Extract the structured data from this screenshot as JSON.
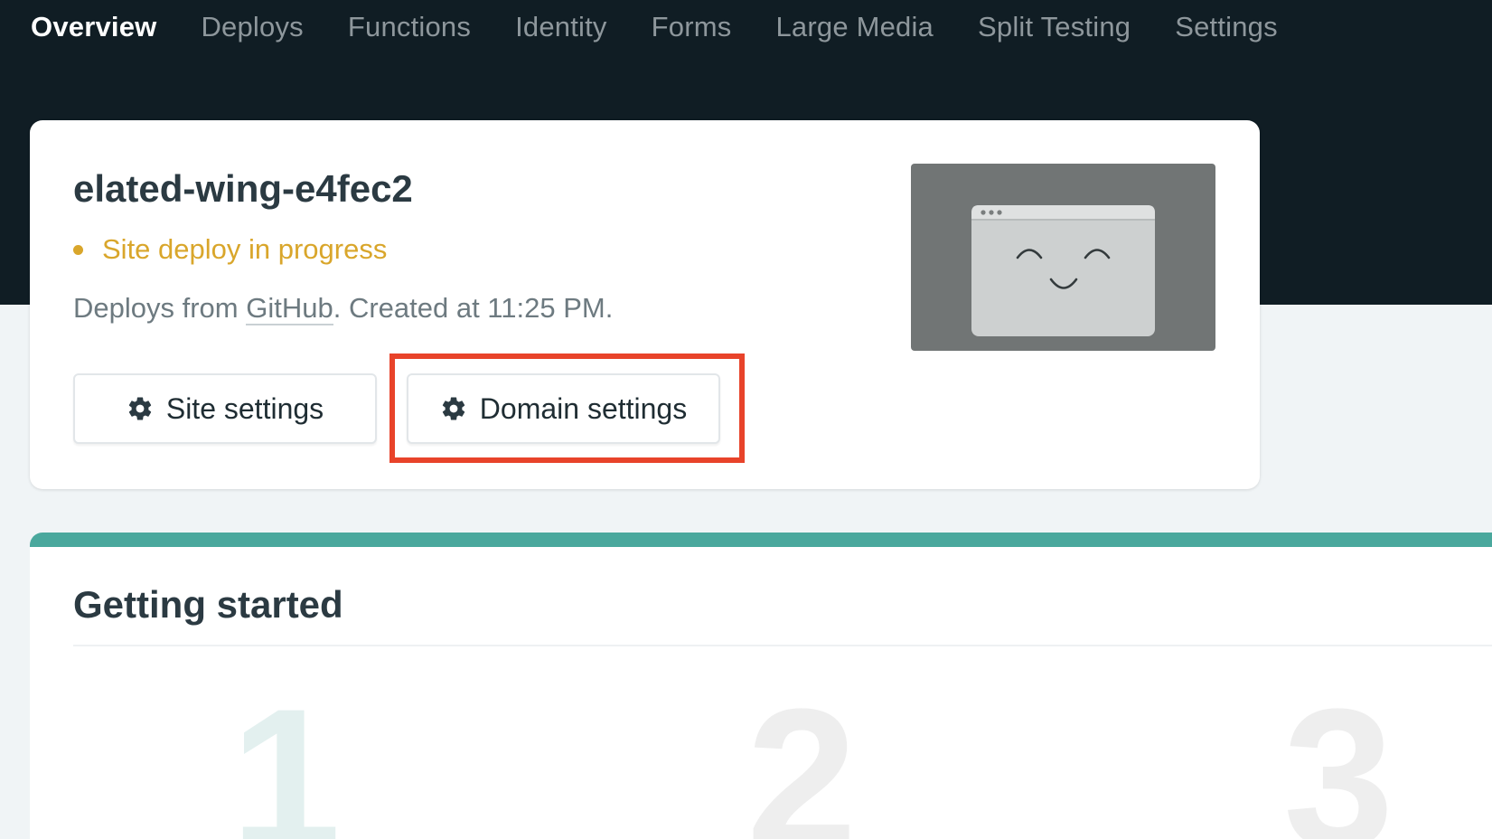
{
  "nav": {
    "tabs": [
      {
        "label": "Overview",
        "active": true
      },
      {
        "label": "Deploys"
      },
      {
        "label": "Functions"
      },
      {
        "label": "Identity"
      },
      {
        "label": "Forms"
      },
      {
        "label": "Large Media"
      },
      {
        "label": "Split Testing"
      },
      {
        "label": "Settings"
      }
    ]
  },
  "site": {
    "name": "elated-wing-e4fec2",
    "status": "Site deploy in progress",
    "meta_prefix": "Deploys from ",
    "meta_link": "GitHub",
    "meta_suffix": ". Created at 11:25 PM.",
    "buttons": {
      "site_settings": "Site settings",
      "domain_settings": "Domain settings"
    }
  },
  "getting_started": {
    "title": "Getting started",
    "steps": [
      "1",
      "2",
      "3"
    ]
  },
  "colors": {
    "nav_bg": "#101d24",
    "status": "#d9a62b",
    "accent_teal": "#4aa89d",
    "highlight": "#e8432a"
  },
  "icons": {
    "button_icon": "gear-icon",
    "preview": "browser-window-smiley-icon"
  }
}
